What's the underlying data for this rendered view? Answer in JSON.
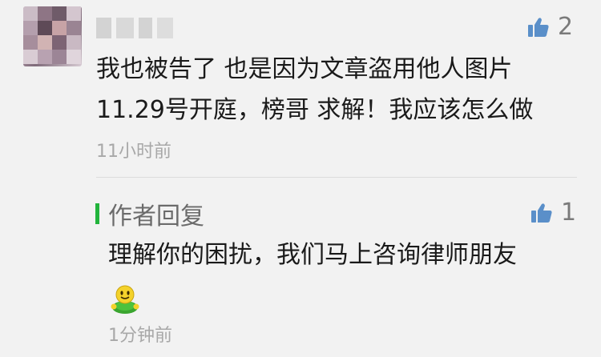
{
  "comment": {
    "author": "",
    "like_count": "2",
    "text_line1": "我也被告了 也是因为文章盗用他人图片",
    "text_line2": "11.29号开庭，榜哥 求解！我应该怎么做",
    "time": "11小时前"
  },
  "reply": {
    "label": "作者回复",
    "like_count": "1",
    "text_line1": "理解你的困扰，我们马上咨询律师朋友",
    "emoji": "smiley-sticker-icon",
    "time": "1分钟前"
  },
  "colors": {
    "background": "#f2f2f2",
    "reply_accent": "#22b43c",
    "meta_text": "#a8a8a8"
  }
}
